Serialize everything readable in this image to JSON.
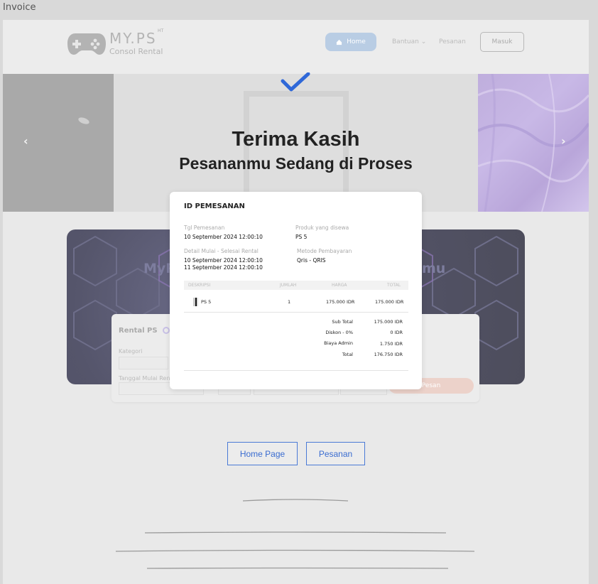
{
  "frame_title": "Invoice",
  "header": {
    "logo_name": "MY.PS",
    "logo_sup": "HT",
    "logo_sub": "Consol Rental",
    "nav_home": "Home",
    "nav_bantuan": "Bantuan",
    "nav_pesanan": "Pesanan",
    "masuk": "Masuk"
  },
  "hero": {
    "title": "Terima Kasih",
    "subtitle": "Pesananmu Sedang di Proses"
  },
  "banner": {
    "text_left": "MyP",
    "text_right": "mu"
  },
  "form": {
    "title": "Rental PS",
    "kategori_label": "Kategori",
    "tanggal_label": "Tanggal Mulai Ren",
    "pesan_button": "Pesan"
  },
  "invoice": {
    "title": "ID PEMESANAN",
    "tgl_label": "Tgl Pemesanan",
    "tgl_value": "10 September 2024  12:00:10",
    "produk_label": "Produk yang disewa",
    "produk_value": "PS 5",
    "detail_label": "Detail Mulai - Selesai Rental",
    "detail_value_1": "10 September 2024  12:00:10",
    "detail_value_2": "11 September 2024  12:00:10",
    "metode_label": "Metode Pembayaran",
    "metode_value": "Qris - QRIS",
    "columns": {
      "deskripsi": "DESKRIPSI",
      "jumlah": "JUMLAH",
      "harga": "HARGA",
      "total": "TOTAL"
    },
    "item": {
      "name": "PS 5",
      "qty": "1",
      "harga": "175.000 IDR",
      "total": "175.000 IDR"
    },
    "summary": {
      "subtotal_label": "Sub Total",
      "subtotal_value": "175.000 IDR",
      "diskon_label": "Diskon - 0%",
      "diskon_value": "0 IDR",
      "admin_label": "Biaya Admin",
      "admin_value": "1.750 IDR",
      "total_label": "Total",
      "total_value": "176.750 IDR"
    }
  },
  "actions": {
    "home_page": "Home Page",
    "pesanan": "Pesanan"
  },
  "colors": {
    "accent_blue": "#3a6cd0",
    "check_blue": "#2f68d8",
    "hero_purple": "#c8b8e6"
  }
}
